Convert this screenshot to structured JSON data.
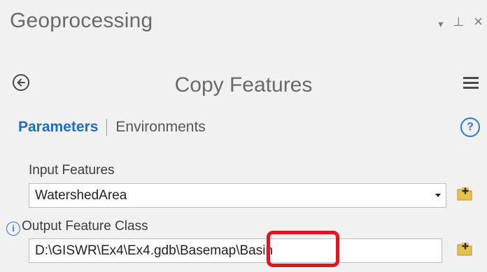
{
  "pane": {
    "title": "Geoprocessing",
    "controls": {
      "menu_glyph": "▾",
      "pin_glyph": "⊥",
      "close_glyph": "×"
    }
  },
  "tool": {
    "title": "Copy Features",
    "back_icon": "back-circle-icon",
    "menu_icon": "hamburger-menu-icon"
  },
  "tabs": {
    "parameters": "Parameters",
    "environments": "Environments",
    "help_glyph": "?"
  },
  "fields": {
    "input_features": {
      "label": "Input Features",
      "value": "WatershedArea"
    },
    "output_feature_class": {
      "label": "Output Feature Class",
      "value": "D:\\GISWR\\Ex4\\Ex4.gdb\\Basemap\\Basin",
      "info_glyph": "i"
    }
  },
  "colors": {
    "accent": "#1e6fbf",
    "highlight": "#e3141f",
    "folder": "#e6c24a"
  }
}
